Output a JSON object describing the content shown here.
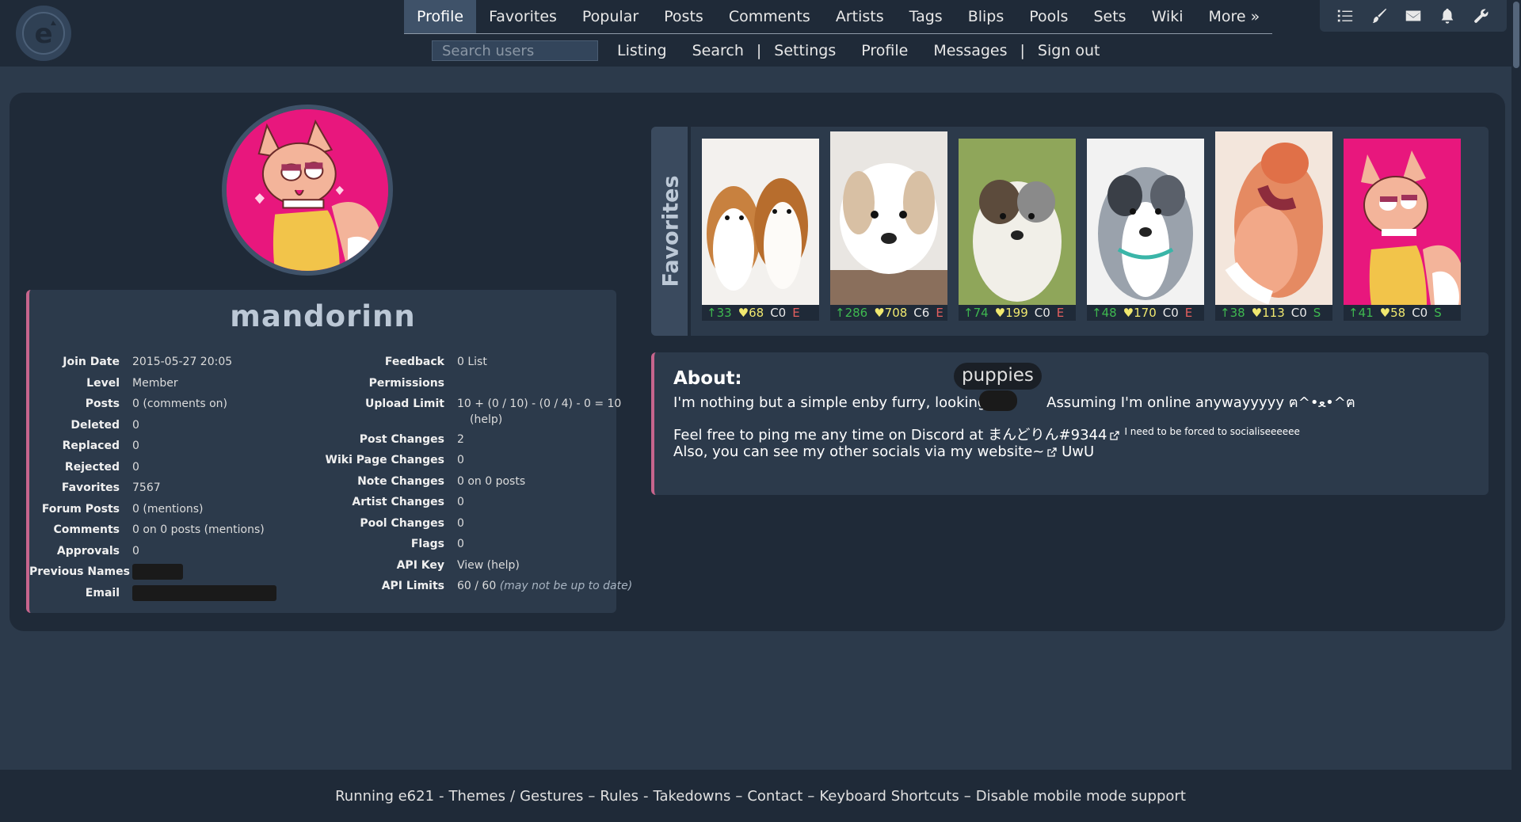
{
  "nav": {
    "main_items": [
      "Profile",
      "Favorites",
      "Popular",
      "Posts",
      "Comments",
      "Artists",
      "Tags",
      "Blips",
      "Pools",
      "Sets",
      "Wiki",
      "More »"
    ],
    "active": "Profile",
    "search_placeholder": "Search users",
    "sub_items": [
      "Listing",
      "Search",
      "|",
      "Settings",
      "Profile",
      "Messages",
      "|",
      "Sign out"
    ],
    "tool_icons": [
      "tasks-icon",
      "brush-icon",
      "mail-icon",
      "bell-icon",
      "wrench-icon"
    ]
  },
  "profile": {
    "username": "mandorinn",
    "left_stats": [
      {
        "label": "Join Date",
        "value": "2015-05-27 20:05"
      },
      {
        "label": "Level",
        "value": "Member"
      },
      {
        "label": "Posts",
        "value": "0 (comments on)"
      },
      {
        "label": "Deleted",
        "value": "0"
      },
      {
        "label": "Replaced",
        "value": "0"
      },
      {
        "label": "Rejected",
        "value": "0"
      },
      {
        "label": "Favorites",
        "value": "7567"
      },
      {
        "label": "Forum Posts",
        "value": "0 (mentions)"
      },
      {
        "label": "Comments",
        "value": "0 on 0 posts (mentions)"
      },
      {
        "label": "Approvals",
        "value": "0"
      },
      {
        "label": "Previous Names",
        "value": ""
      },
      {
        "label": "Email",
        "value": ""
      }
    ],
    "right_stats": [
      {
        "label": "Feedback",
        "value": "0 List"
      },
      {
        "label": "Permissions",
        "value": ""
      },
      {
        "label": "Upload Limit",
        "value": "10 + (0 / 10) - (0 / 4) - 0 = 10"
      },
      {
        "label": "Post Changes",
        "value": "2"
      },
      {
        "label": "Wiki Page Changes",
        "value": "0"
      },
      {
        "label": "Note Changes",
        "value": "0 on 0 posts"
      },
      {
        "label": "Artist Changes",
        "value": "0"
      },
      {
        "label": "Pool Changes",
        "value": "0"
      },
      {
        "label": "Flags",
        "value": "0"
      },
      {
        "label": "API Key",
        "value": "View (help)"
      },
      {
        "label": "API Limits",
        "value": "60 / 60"
      }
    ],
    "upload_help": "(help)",
    "api_limits_note": "(may not be up to date)"
  },
  "favorites": {
    "label": "Favorites",
    "items": [
      {
        "up": "↑33",
        "fav": "♥68",
        "com": "C0",
        "rating": "E"
      },
      {
        "up": "↑286",
        "fav": "♥708",
        "com": "C6",
        "rating": "E"
      },
      {
        "up": "↑74",
        "fav": "♥199",
        "com": "C0",
        "rating": "E"
      },
      {
        "up": "↑48",
        "fav": "♥170",
        "com": "C0",
        "rating": "E"
      },
      {
        "up": "↑38",
        "fav": "♥113",
        "com": "C0",
        "rating": "S"
      },
      {
        "up": "↑41",
        "fav": "♥58",
        "com": "C0",
        "rating": "S"
      }
    ]
  },
  "about": {
    "title": "About:",
    "line1_a": "I'm nothing but a simple enby furry, looking at",
    "line1_b": "Assuming I'm online anywayyyyy ฅ^•ﻌ•^ฅ",
    "tooltip": "puppies",
    "line2_a": "Feel free to ping me any time on Discord at ",
    "line2_link": "まんどりん#9344",
    "line2_small": "I need to be forced to socialiseeeeee",
    "line3_a": "Also, you can see my other socials via my ",
    "line3_link": "website~",
    "line3_b": " UwU"
  },
  "footer": {
    "items": [
      "Running e621",
      "-",
      "Themes",
      "/",
      "Gestures",
      "–",
      "Rules",
      "-",
      "Takedowns",
      "–",
      "Contact",
      "–",
      "Keyboard Shortcuts",
      "–",
      "Disable mobile mode support"
    ]
  }
}
